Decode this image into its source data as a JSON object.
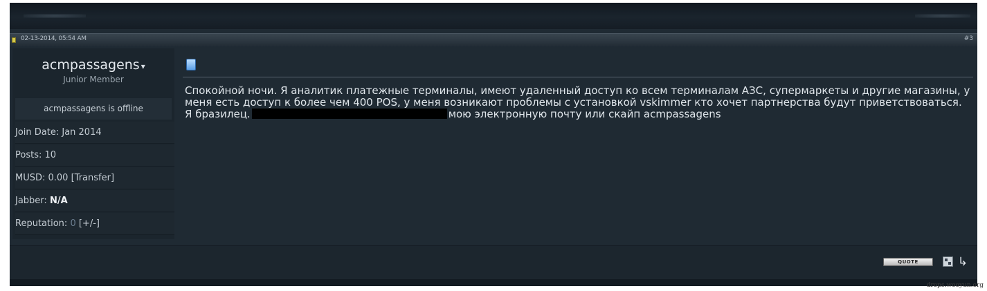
{
  "post": {
    "date": "02-13-2014, 05:54 AM",
    "number": "#3"
  },
  "user": {
    "username": "acmpassagens",
    "caret": "▾",
    "title": "Junior Member",
    "online_status": "acmpassagens is offline",
    "join_date": "Join Date: Jan 2014",
    "posts": "Posts: 10",
    "musd_label": "MUSD: 0.00",
    "musd_transfer": "[Transfer]",
    "jabber_label": "Jabber:",
    "jabber_value": "N/A",
    "reputation_label": "Reputation:",
    "reputation_value": "0",
    "reputation_link": "[+/-]"
  },
  "message": {
    "text_before": "Спокойной ночи. Я аналитик платежные терминалы, имеют удаленный доступ ко всем терминалам АЗС, супермаркеты и другие магазины, у меня есть доступ к более чем 400 POS, у меня возникают проблемы с установкой vskimmer кто хочет партнерства будут приветствоваться. Я бразилец.",
    "text_after": "мою электронную почту или скайп acmpassagens"
  },
  "footer": {
    "quote_label": "QUOTE",
    "reply_icon": "↳"
  },
  "watermark": "drops.wooyun.org",
  "icons": {
    "post_status": "post-status-icon",
    "document": "document-icon",
    "multiquote": "multiquote-icon",
    "reply": "reply-icon"
  }
}
